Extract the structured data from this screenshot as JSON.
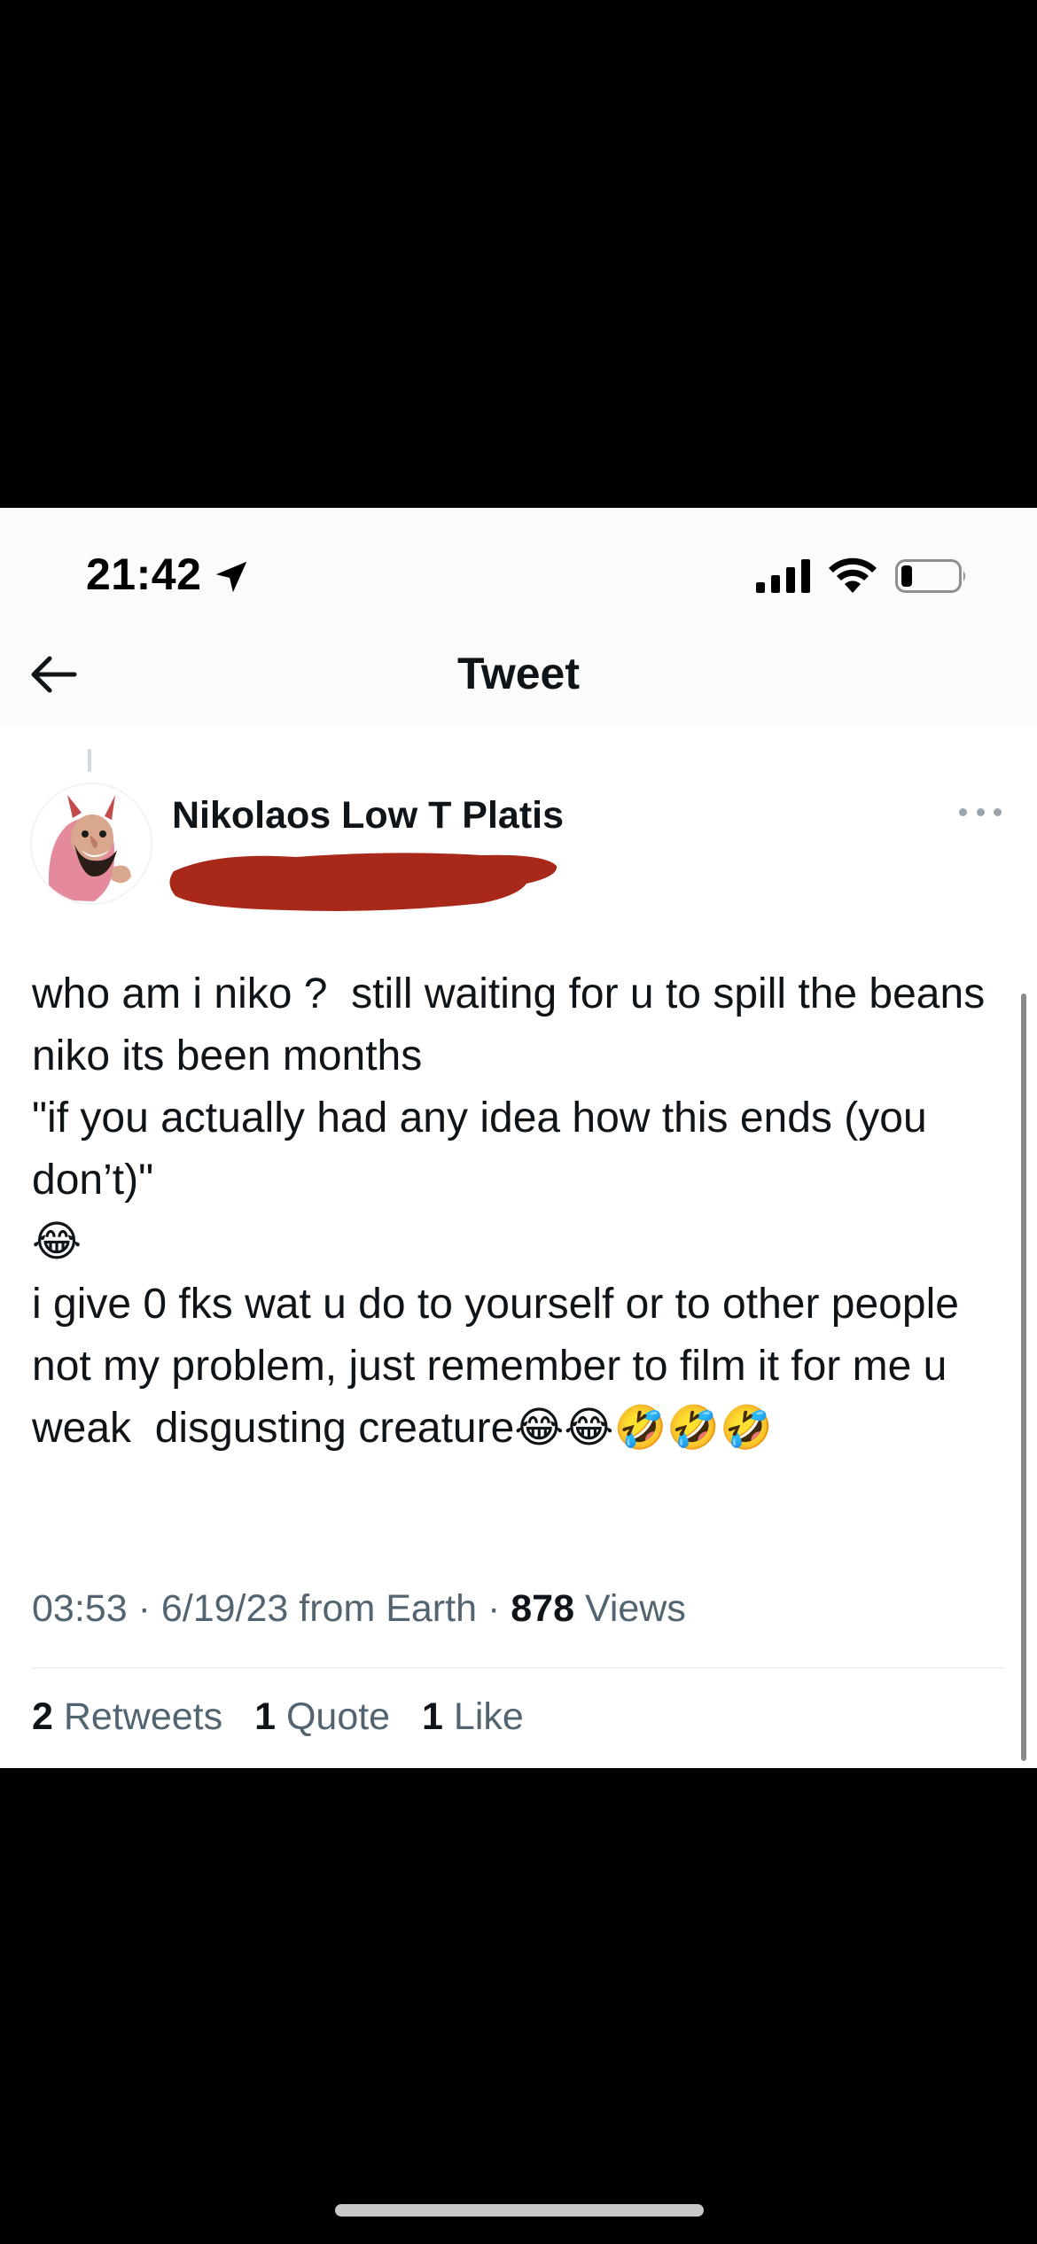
{
  "status_bar": {
    "time": "21:42"
  },
  "nav": {
    "title": "Tweet"
  },
  "tweet": {
    "display_name": "Nikolaos Low T Platis",
    "text_lines": [
      "who am i niko ?  still waiting for u to spill the beans niko its been months",
      "\"if you actually had any idea how this ends (you don’t)\"",
      "😂",
      "i give 0 fks wat u do to yourself or to other people not my problem, just remember to film it for me u weak  disgusting creature😂😂🤣🤣🤣"
    ],
    "time": "03:53",
    "date": "6/19/23",
    "source": "from Earth",
    "separator": "·",
    "views_count": "878",
    "views_label": "Views"
  },
  "stats": {
    "retweets_count": "2",
    "retweets_label": "Retweets",
    "quotes_count": "1",
    "quotes_label": "Quote",
    "likes_count": "1",
    "likes_label": "Like"
  },
  "icons": {
    "back": "back-arrow-icon",
    "location": "location-arrow-icon",
    "signal": "cellular-signal-icon",
    "wifi": "wifi-icon",
    "battery": "battery-icon",
    "more": "more-options-icon"
  },
  "colors": {
    "primary_text": "#0f1419",
    "secondary_text": "#536471",
    "redaction": "#a8291a",
    "divider": "#eff3f4"
  },
  "battery_level": 0.2
}
